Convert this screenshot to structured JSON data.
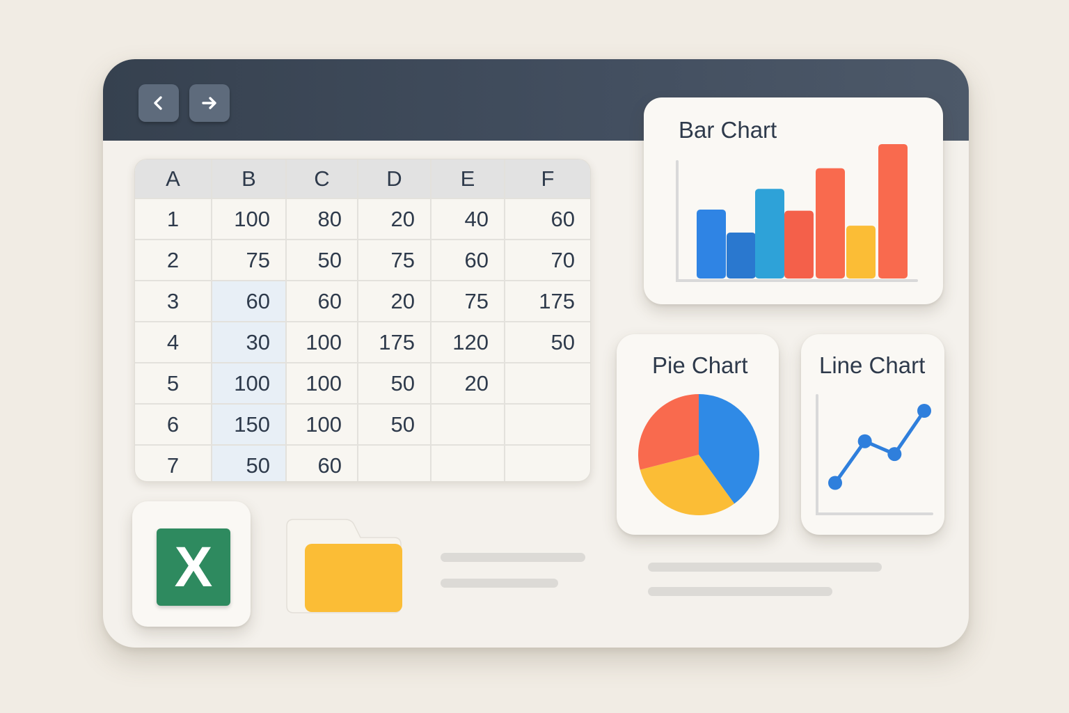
{
  "colors": {
    "titlebar": "#3c4757",
    "excel_green": "#2e8a5f",
    "folder_yellow": "#fbbd36",
    "blue": "#2f8ae6",
    "red": "#f96a4e",
    "yellow": "#fbbd36"
  },
  "toolbar": {
    "back_icon": "chevron-left-icon",
    "forward_icon": "arrow-right-icon"
  },
  "spreadsheet": {
    "columns": [
      "A",
      "B",
      "C",
      "D",
      "E",
      "F"
    ],
    "rows": [
      [
        "1",
        "100",
        "80",
        "20",
        "40",
        "60"
      ],
      [
        "2",
        "75",
        "50",
        "75",
        "60",
        "70"
      ],
      [
        "3",
        "60",
        "60",
        "20",
        "75",
        "175"
      ],
      [
        "4",
        "30",
        "100",
        "175",
        "120",
        "50"
      ],
      [
        "5",
        "100",
        "100",
        "50",
        "20",
        ""
      ],
      [
        "6",
        "150",
        "100",
        "50",
        "",
        ""
      ],
      [
        "7",
        "50",
        "60",
        "",
        "",
        ""
      ]
    ]
  },
  "chart_data": [
    {
      "type": "bar",
      "title": "Bar Chart",
      "values": [
        60,
        40,
        78,
        59,
        96,
        46,
        117
      ],
      "colors": [
        "#2f84e4",
        "#2a78cf",
        "#2ea2d8",
        "#f4604a",
        "#f96a4e",
        "#fbbd36",
        "#f96a4e"
      ],
      "ylim": [
        0,
        120
      ],
      "grid": false
    },
    {
      "type": "pie",
      "title": "Pie Chart",
      "values": [
        40,
        31,
        29
      ],
      "colors": [
        "#2f8ae6",
        "#fbbd36",
        "#f96a4e"
      ]
    },
    {
      "type": "line",
      "title": "Line Chart",
      "x": [
        1,
        2,
        3,
        4
      ],
      "y": [
        10,
        62,
        46,
        100
      ],
      "color": "#2f7fdc",
      "ylim": [
        0,
        120
      ],
      "grid": false
    }
  ],
  "dock": {
    "excel_icon": "excel-icon",
    "excel_letter": "X",
    "folder_icon": "folder-icon"
  }
}
